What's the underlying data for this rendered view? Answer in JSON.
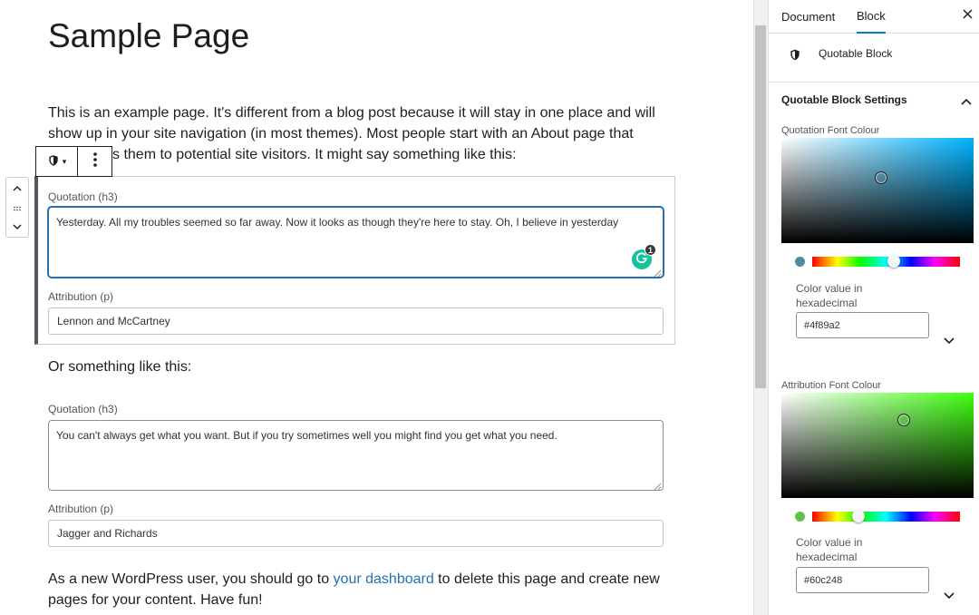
{
  "editor": {
    "page_title": "Sample Page",
    "intro_line1": "This is an example page. It's different from a blog post because it will stay in one place and will",
    "intro_line2": "show up in your site navigation (in most themes). Most people start with an About page that",
    "intro_line3": "s them to potential site visitors. It might say something like this:",
    "block1": {
      "quotation_label": "Quotation (h3)",
      "quotation_value": "Yesterday. All my troubles seemed so far away. Now it looks as though they're here to stay. Oh, I believe in yesterday",
      "attribution_label": "Attribution (p)",
      "attribution_value": "Lennon and McCartney"
    },
    "between_text": "Or something like this:",
    "block2": {
      "quotation_label": "Quotation (h3)",
      "quotation_value": "You can't always get what you want. But if you try sometimes well you might find you get what you need.",
      "attribution_label": "Attribution (p)",
      "attribution_value": "Jagger and Richards"
    },
    "outro_before_link": "As a new WordPress user, you should go to ",
    "outro_link": "your dashboard",
    "outro_after_link": " to delete this page and create new",
    "outro_line2": "pages for your content. Have fun!",
    "grammarly_count": "1"
  },
  "icons": {
    "block_icon": "shield-icon",
    "more_options": "vertical-ellipsis-icon",
    "move_up": "chevron-up-icon",
    "drag_handle": "drag-handle-icon",
    "move_down": "chevron-down-icon",
    "grammarly": "grammarly-icon",
    "close": "close-icon"
  },
  "sidebar": {
    "tabs": [
      {
        "label": "Document"
      },
      {
        "label": "Block"
      }
    ],
    "block_name": "Quotable Block",
    "panel_title": "Quotable Block Settings",
    "quotation_colour": {
      "label": "Quotation Font Colour",
      "hex_label": "Color value in hexadecimal",
      "hex_value": "#4f89a2",
      "hue_color": "#00b3ff",
      "hue_position": 0.55
    },
    "attribution_colour": {
      "label": "Attribution Font Colour",
      "hex_label": "Color value in hexadecimal",
      "hex_value": "#60c248",
      "hue_color": "#40ff10",
      "hue_position": 0.31
    }
  },
  "colors": {
    "accent": "#007cba",
    "focus": "#2271b1",
    "link": "#2271b1",
    "grammarly": "#15c39a"
  }
}
